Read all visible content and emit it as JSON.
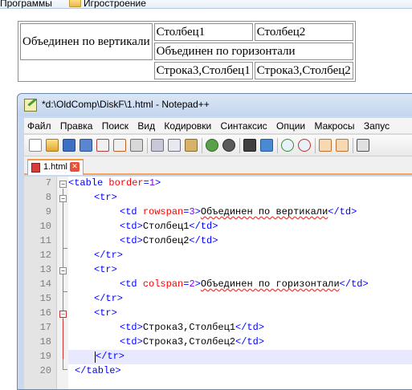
{
  "bookmarks": [
    {
      "label": "Программы"
    },
    {
      "label": "Игростроение"
    }
  ],
  "rendered_table": {
    "row1": {
      "merged_vertical": "Объединен по вертикали",
      "c1": "Столбец1",
      "c2": "Столбец2"
    },
    "row2": {
      "merged_horizontal": "Объединен по горизонтали"
    },
    "row3": {
      "c1": "Строка3,Столбец1",
      "c2": "Строка3,Столбец2"
    }
  },
  "window": {
    "title": "*d:\\OldComp\\DiskF\\1.html - Notepad++",
    "menu": [
      "Файл",
      "Правка",
      "Поиск",
      "Вид",
      "Кодировки",
      "Синтаксис",
      "Опции",
      "Макросы",
      "Запус"
    ],
    "tab": {
      "label": "1.html"
    }
  },
  "editor": {
    "current_line": 19,
    "lines": [
      {
        "n": "7"
      },
      {
        "n": "8"
      },
      {
        "n": "9"
      },
      {
        "n": "10"
      },
      {
        "n": "11"
      },
      {
        "n": "12"
      },
      {
        "n": "13"
      },
      {
        "n": "14"
      },
      {
        "n": "15"
      },
      {
        "n": "16"
      },
      {
        "n": "17"
      },
      {
        "n": "18"
      },
      {
        "n": "19"
      },
      {
        "n": "20"
      }
    ],
    "code": {
      "l7_tag": "<table ",
      "l7_attr": "border",
      "l7_eq": "=",
      "l7_val": "1",
      "l7_close": ">",
      "l8_tag": "<tr>",
      "l9_open": "<td ",
      "l9_attr": "rowspan",
      "l9_eq": "=",
      "l9_val": "3",
      "l9_gt": ">",
      "l9_text": "Объединен по вертикали",
      "l9_end": "</td>",
      "l10_open": "<td>",
      "l10_text": "Столбец1",
      "l10_end": "</td>",
      "l11_open": "<td>",
      "l11_text": "Столбец2",
      "l11_end": "</td>",
      "l12_tag": "</tr>",
      "l13_tag": "<tr>",
      "l14_open": "<td ",
      "l14_attr": "colspan",
      "l14_eq": "=",
      "l14_val": "2",
      "l14_gt": ">",
      "l14_text": "Объединен по горизонтали",
      "l14_end": "</td>",
      "l15_tag": "</tr>",
      "l16_tag": "<tr>",
      "l17_open": "<td>",
      "l17_text": "Строка3,Столбец1",
      "l17_end": "</td>",
      "l18_open": "<td>",
      "l18_text": "Строка3,Столбец2",
      "l18_end": "</td>",
      "l19_tag": "</tr>",
      "l20_tag": "</table>"
    }
  },
  "toolbar_icons": [
    "new-file-icon",
    "open-file-icon",
    "save-icon",
    "save-all-icon",
    "close-icon",
    "close-all-icon",
    "print-icon",
    "cut-icon",
    "copy-icon",
    "paste-icon",
    "undo-icon",
    "redo-icon",
    "find-icon",
    "replace-icon",
    "zoom-in-icon",
    "zoom-out-icon",
    "sync-v-icon",
    "sync-h-icon",
    "wrap-icon"
  ],
  "colors": {
    "tag": "#0000ff",
    "attribute": "#ff0000",
    "value": "#8000ff",
    "tab_accent": "#f59b3b",
    "current_line_bg": "#e8e8ff"
  }
}
